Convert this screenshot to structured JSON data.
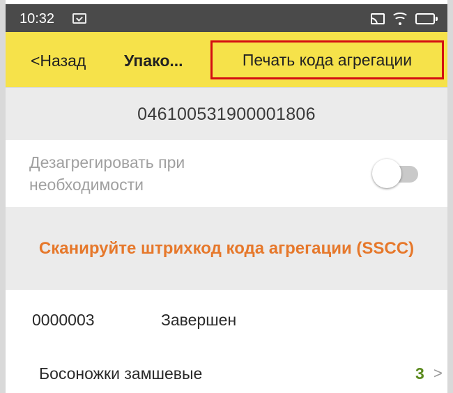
{
  "status_bar": {
    "time": "10:32",
    "icons": [
      "message-icon",
      "cast-icon",
      "wifi-icon",
      "battery-icon"
    ]
  },
  "header": {
    "back_label": "<Назад",
    "title": "Упако...",
    "print_button_label": "Печать кода агрегации",
    "highlight_color": "#d40d12",
    "background": "#f6e24a"
  },
  "code": "046100531900001806",
  "disaggregate": {
    "label": "Дезагрегировать при необходимости",
    "enabled": false
  },
  "scan_prompt": "Сканируйте штрихкод кода агрегации (SSCC)",
  "record": {
    "number": "0000003",
    "status": "Завершен"
  },
  "items": [
    {
      "name": "Босоножки замшевые",
      "quantity": "3",
      "chevron": ">"
    }
  ],
  "colors": {
    "accent_orange": "#e6782b",
    "quantity_green": "#5b8a1f"
  }
}
